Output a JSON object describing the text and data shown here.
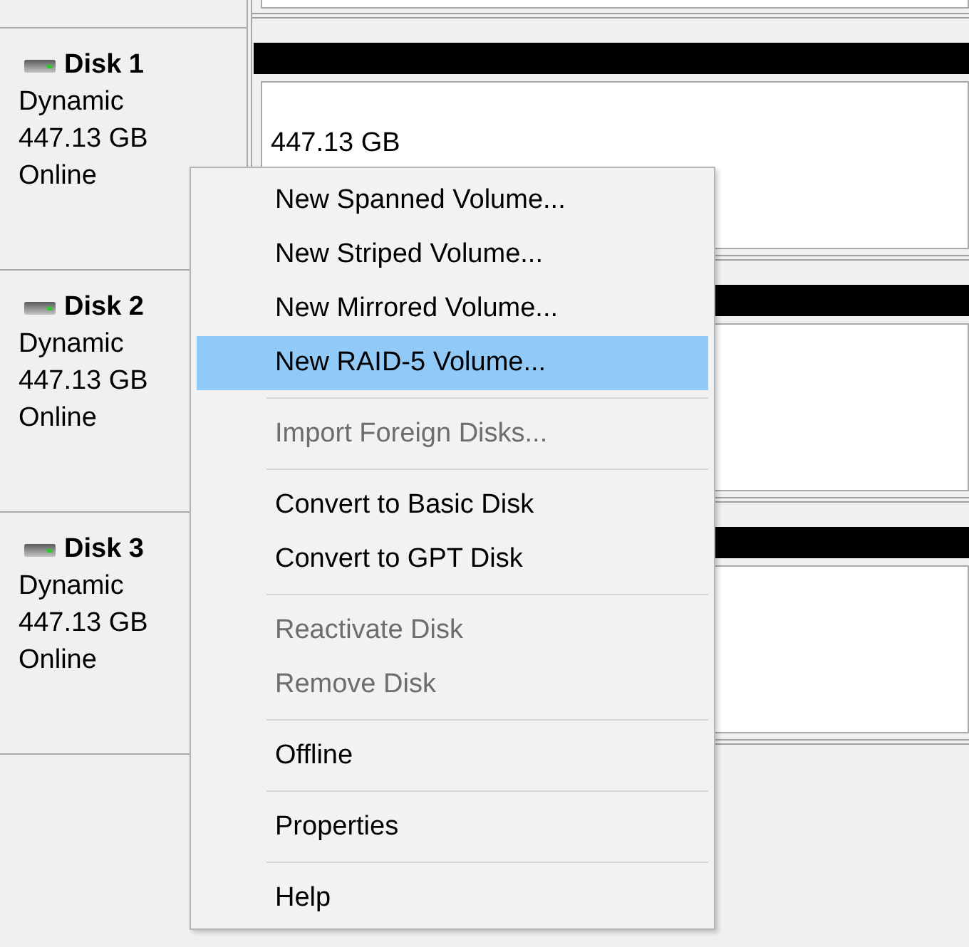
{
  "disks": [
    {
      "name": "Disk 1",
      "type": "Dynamic",
      "capacity": "447.13 GB",
      "status": "Online",
      "volume_size": "447.13 GB"
    },
    {
      "name": "Disk 2",
      "type": "Dynamic",
      "capacity": "447.13 GB",
      "status": "Online"
    },
    {
      "name": "Disk 3",
      "type": "Dynamic",
      "capacity": "447.13 GB",
      "status": "Online"
    }
  ],
  "context_menu": {
    "items": [
      {
        "kind": "item",
        "label": "New Spanned Volume...",
        "disabled": false,
        "selected": false
      },
      {
        "kind": "item",
        "label": "New Striped Volume...",
        "disabled": false,
        "selected": false
      },
      {
        "kind": "item",
        "label": "New Mirrored Volume...",
        "disabled": false,
        "selected": false
      },
      {
        "kind": "item",
        "label": "New RAID-5 Volume...",
        "disabled": false,
        "selected": true
      },
      {
        "kind": "separator"
      },
      {
        "kind": "item",
        "label": "Import Foreign Disks...",
        "disabled": true,
        "selected": false
      },
      {
        "kind": "separator"
      },
      {
        "kind": "item",
        "label": "Convert to Basic Disk",
        "disabled": false,
        "selected": false
      },
      {
        "kind": "item",
        "label": "Convert to GPT Disk",
        "disabled": false,
        "selected": false
      },
      {
        "kind": "separator"
      },
      {
        "kind": "item",
        "label": "Reactivate Disk",
        "disabled": true,
        "selected": false
      },
      {
        "kind": "item",
        "label": "Remove Disk",
        "disabled": true,
        "selected": false
      },
      {
        "kind": "separator"
      },
      {
        "kind": "item",
        "label": "Offline",
        "disabled": false,
        "selected": false
      },
      {
        "kind": "separator"
      },
      {
        "kind": "item",
        "label": "Properties",
        "disabled": false,
        "selected": false
      },
      {
        "kind": "separator"
      },
      {
        "kind": "item",
        "label": "Help",
        "disabled": false,
        "selected": false
      }
    ]
  }
}
